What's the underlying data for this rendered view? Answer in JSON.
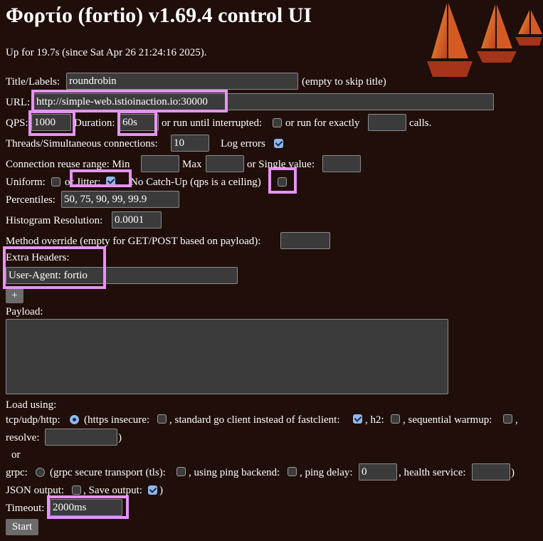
{
  "header": {
    "title": "Φορτίο (fortio) v1.69.4 control UI",
    "uptime": "Up for 19.7s (since Sat Apr 26 21:24:16 2025)."
  },
  "form": {
    "title_label": "Title/Labels:",
    "title_value": "roundrobin",
    "title_hint": "(empty to skip title)",
    "url_label": "URL:",
    "url_value": "http://simple-web.istioinaction.io:30000",
    "qps_label": "QPS:",
    "qps_value": "1000",
    "duration_label": "Duration:",
    "duration_value": "60s",
    "run_until_label": "or run until interrupted:",
    "run_exactly_label": "or run for exactly",
    "calls_value": "",
    "calls_label": "calls.",
    "threads_label": "Threads/Simultaneous connections:",
    "threads_value": "10",
    "log_errors_label": "Log errors",
    "conn_reuse_label": "Connection reuse range: Min",
    "conn_min_value": "",
    "max_label": "Max",
    "conn_max_value": "",
    "single_value_label": "or Single value:",
    "single_value": "",
    "uniform_label": "Uniform:",
    "jitter_label": "or Jitter:",
    "nocatchup_label": "No Catch-Up (qps is a ceiling)",
    "percentiles_label": "Percentiles:",
    "percentiles_value": "50, 75, 90, 99, 99.9",
    "histogram_label": "Histogram Resolution:",
    "histogram_value": "0.0001",
    "method_label": "Method override (empty for GET/POST based on payload):",
    "method_value": "",
    "headers_label": "Extra Headers:",
    "header_value": "User-Agent: fortio",
    "add_header_label": "+",
    "payload_label": "Payload:",
    "payload_value": "",
    "load_using_label": "Load using:",
    "http_label": "tcp/udp/http:",
    "https_insecure_label": "(https insecure:",
    "stdclient_label": ", standard go client instead of fastclient:",
    "h2_label": ", h2:",
    "warmup_label": ", sequential warmup:",
    "warmup_comma": ",",
    "resolve_label": "resolve:",
    "resolve_value": "",
    "resolve_close": ")",
    "or_label": "or",
    "grpc_label": "grpc:",
    "grpc_tls_label": "(grpc secure transport (tls):",
    "ping_backend_label": ", using ping backend:",
    "ping_delay_label": ", ping delay:",
    "ping_delay_value": "0",
    "health_label": ", health service:",
    "health_value": "",
    "grpc_close": ")",
    "json_label": "JSON output:",
    "save_label": ", Save output:",
    "save_close": ")",
    "timeout_label": "Timeout:",
    "timeout_value": "2000ms",
    "start_label": "Start"
  },
  "state": {
    "run_until_interrupted": false,
    "log_errors": true,
    "uniform": false,
    "jitter": true,
    "no_catchup": false,
    "mode": "http",
    "https_insecure": false,
    "std_client": true,
    "h2": false,
    "sequential_warmup": false,
    "grpc_tls": false,
    "ping_backend": false,
    "json_output": false,
    "save_output": true
  },
  "colors": {
    "background": "#1f0e0a",
    "highlight": "#e594f4",
    "checkbox_on": "#8fb7ec",
    "logo_orange": "#e0822a",
    "logo_red": "#b5311a"
  },
  "icons": {
    "logo": "fortio-sailboats-logo"
  }
}
